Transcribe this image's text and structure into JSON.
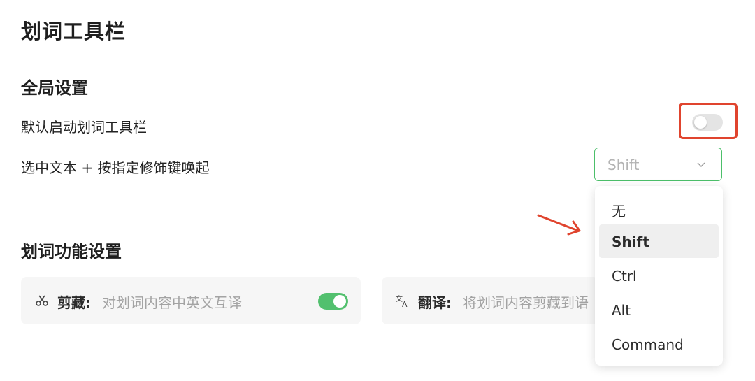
{
  "page": {
    "title": "划词工具栏"
  },
  "global": {
    "heading": "全局设置",
    "default_enable_label": "默认启动划词工具栏",
    "default_enable_on": false,
    "modifier_label": "选中文本 + 按指定修饰键唤起",
    "modifier_value": "Shift",
    "modifier_options": [
      "无",
      "Shift",
      "Ctrl",
      "Alt",
      "Command"
    ],
    "modifier_selected_index": 1
  },
  "features": {
    "heading": "划词功能设置",
    "cards": [
      {
        "icon": "scissors-icon",
        "name": "剪藏",
        "colon": ":",
        "desc": "对划词内容中英文互译",
        "enabled": true
      },
      {
        "icon": "translate-icon",
        "name": "翻译",
        "colon": ":",
        "desc": "将划词内容剪藏到语"
      }
    ]
  },
  "colors": {
    "accent_green": "#52c06e",
    "select_border": "#4cbf6a",
    "highlight_red": "#e0442e",
    "annotation_arrow": "#e0442e"
  }
}
